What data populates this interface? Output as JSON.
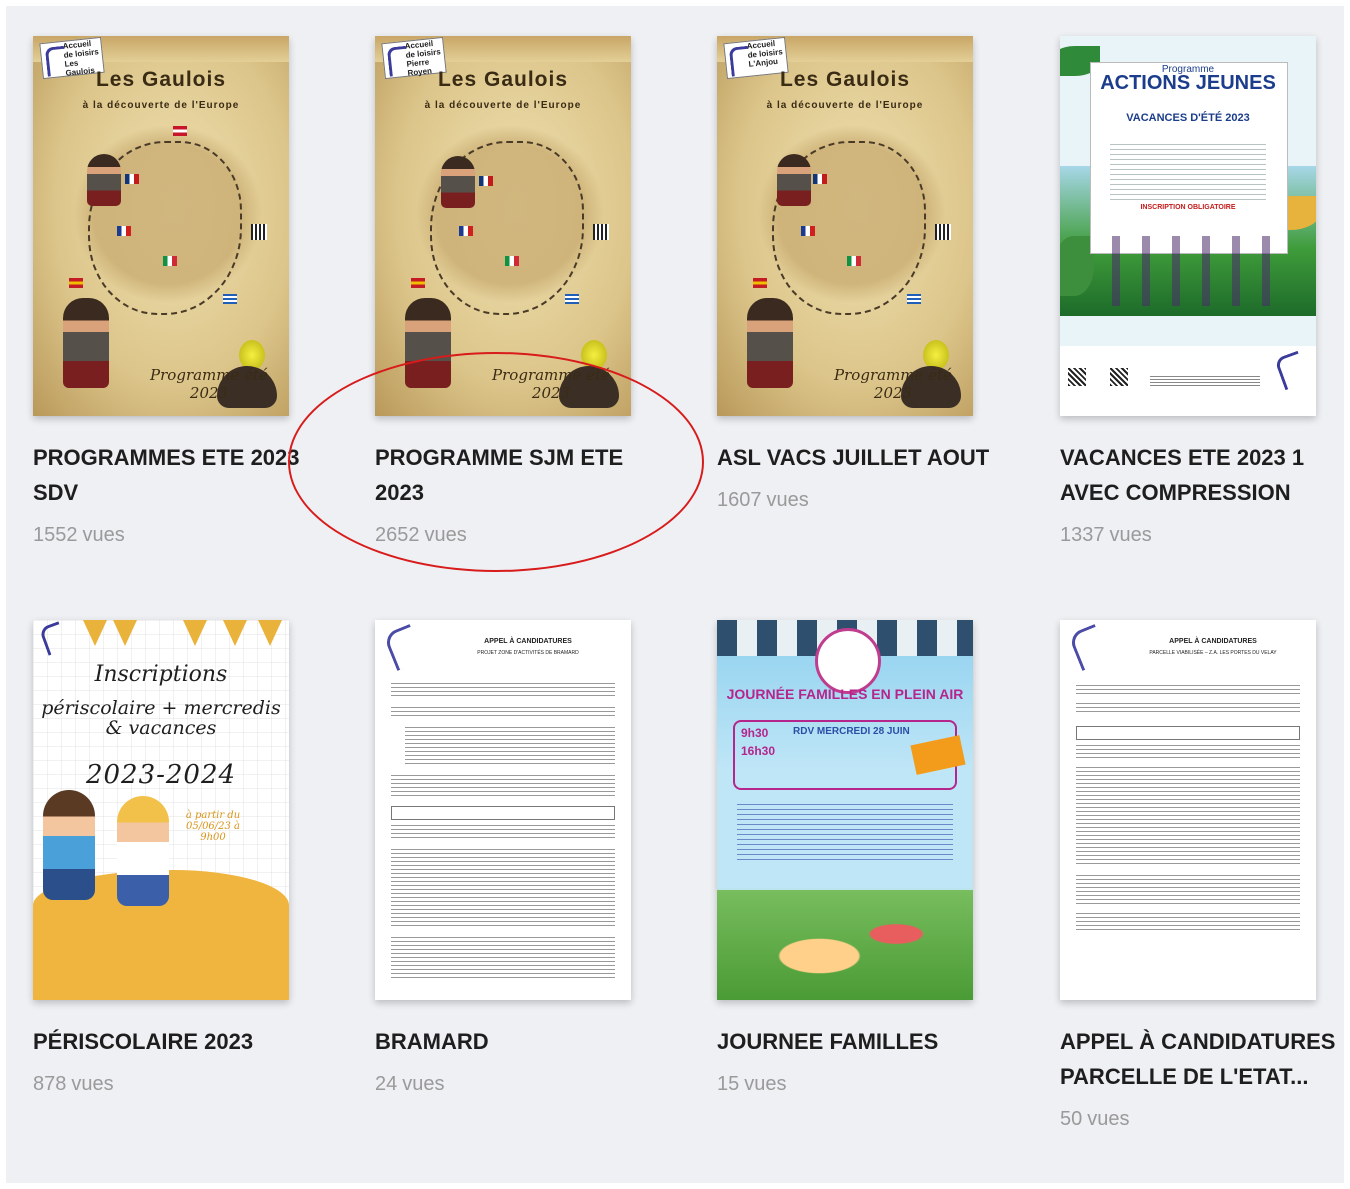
{
  "items": [
    {
      "title": "PROGRAMMES ETE 2023 SDV",
      "views_count": "1552",
      "views_label": "vues",
      "poster": "gaulois",
      "poster_header": "Accueil de loisirs Les Gaulois",
      "poster_title": "Les Gaulois",
      "poster_subtitle": "à la découverte de l'Europe",
      "poster_footer": "Programme été 2023"
    },
    {
      "title": "PROGRAMME SJM ETE 2023",
      "views_count": "2652",
      "views_label": "vues",
      "poster": "gaulois",
      "poster_header": "Accueil de loisirs Pierre Royen",
      "poster_title": "Les Gaulois",
      "poster_subtitle": "à la découverte de l'Europe",
      "poster_footer": "Programme été 2023"
    },
    {
      "title": "ASL VACS JUILLET AOUT",
      "views_count": "1607",
      "views_label": "vues",
      "poster": "gaulois",
      "poster_header": "Accueil de loisirs L'Anjou",
      "poster_title": "Les Gaulois",
      "poster_subtitle": "à la découverte de l'Europe",
      "poster_footer": "Programme été 2023"
    },
    {
      "title": "VACANCES ETE 2023 1 AVEC COMPRESSION",
      "views_count": "1337",
      "views_label": "vues",
      "poster": "actions",
      "poster_kicker": "Programme",
      "poster_title": "ACTIONS JEUNES",
      "poster_subtitle": "VACANCES D'ÉTÉ 2023",
      "poster_note": "INSCRIPTION OBLIGATOIRE"
    },
    {
      "title": "PÉRISCOLAIRE 2023",
      "views_count": "878",
      "views_label": "vues",
      "poster": "peri",
      "poster_line1": "Inscriptions",
      "poster_line2": "périscolaire + mercredis & vacances",
      "poster_line3": "2023-2024",
      "poster_date": "à partir du 05/06/23 à 9h00"
    },
    {
      "title": "BRAMARD",
      "views_count": "24",
      "views_label": "vues",
      "poster": "doc",
      "doc_title": "APPEL À CANDIDATURES",
      "doc_subtitle": "PROJET ZONE D'ACTIVITÉS DE BRAMARD"
    },
    {
      "title": "JOURNEE FAMILLES",
      "views_count": "15",
      "views_label": "vues",
      "poster": "jf",
      "poster_title": "JOURNÉE FAMILLES EN PLEIN AIR",
      "poster_time1": "9h30",
      "poster_time2": "16h30",
      "poster_rdv": "RDV MERCREDI 28 JUIN"
    },
    {
      "title": "APPEL À CANDIDATURES PARCELLE DE L'ETAT...",
      "views_count": "50",
      "views_label": "vues",
      "poster": "doc",
      "doc_title": "APPEL À CANDIDATURES",
      "doc_subtitle": "PARCELLE VIABILISÉE – Z.A. LES PORTES DU VELAY"
    }
  ]
}
